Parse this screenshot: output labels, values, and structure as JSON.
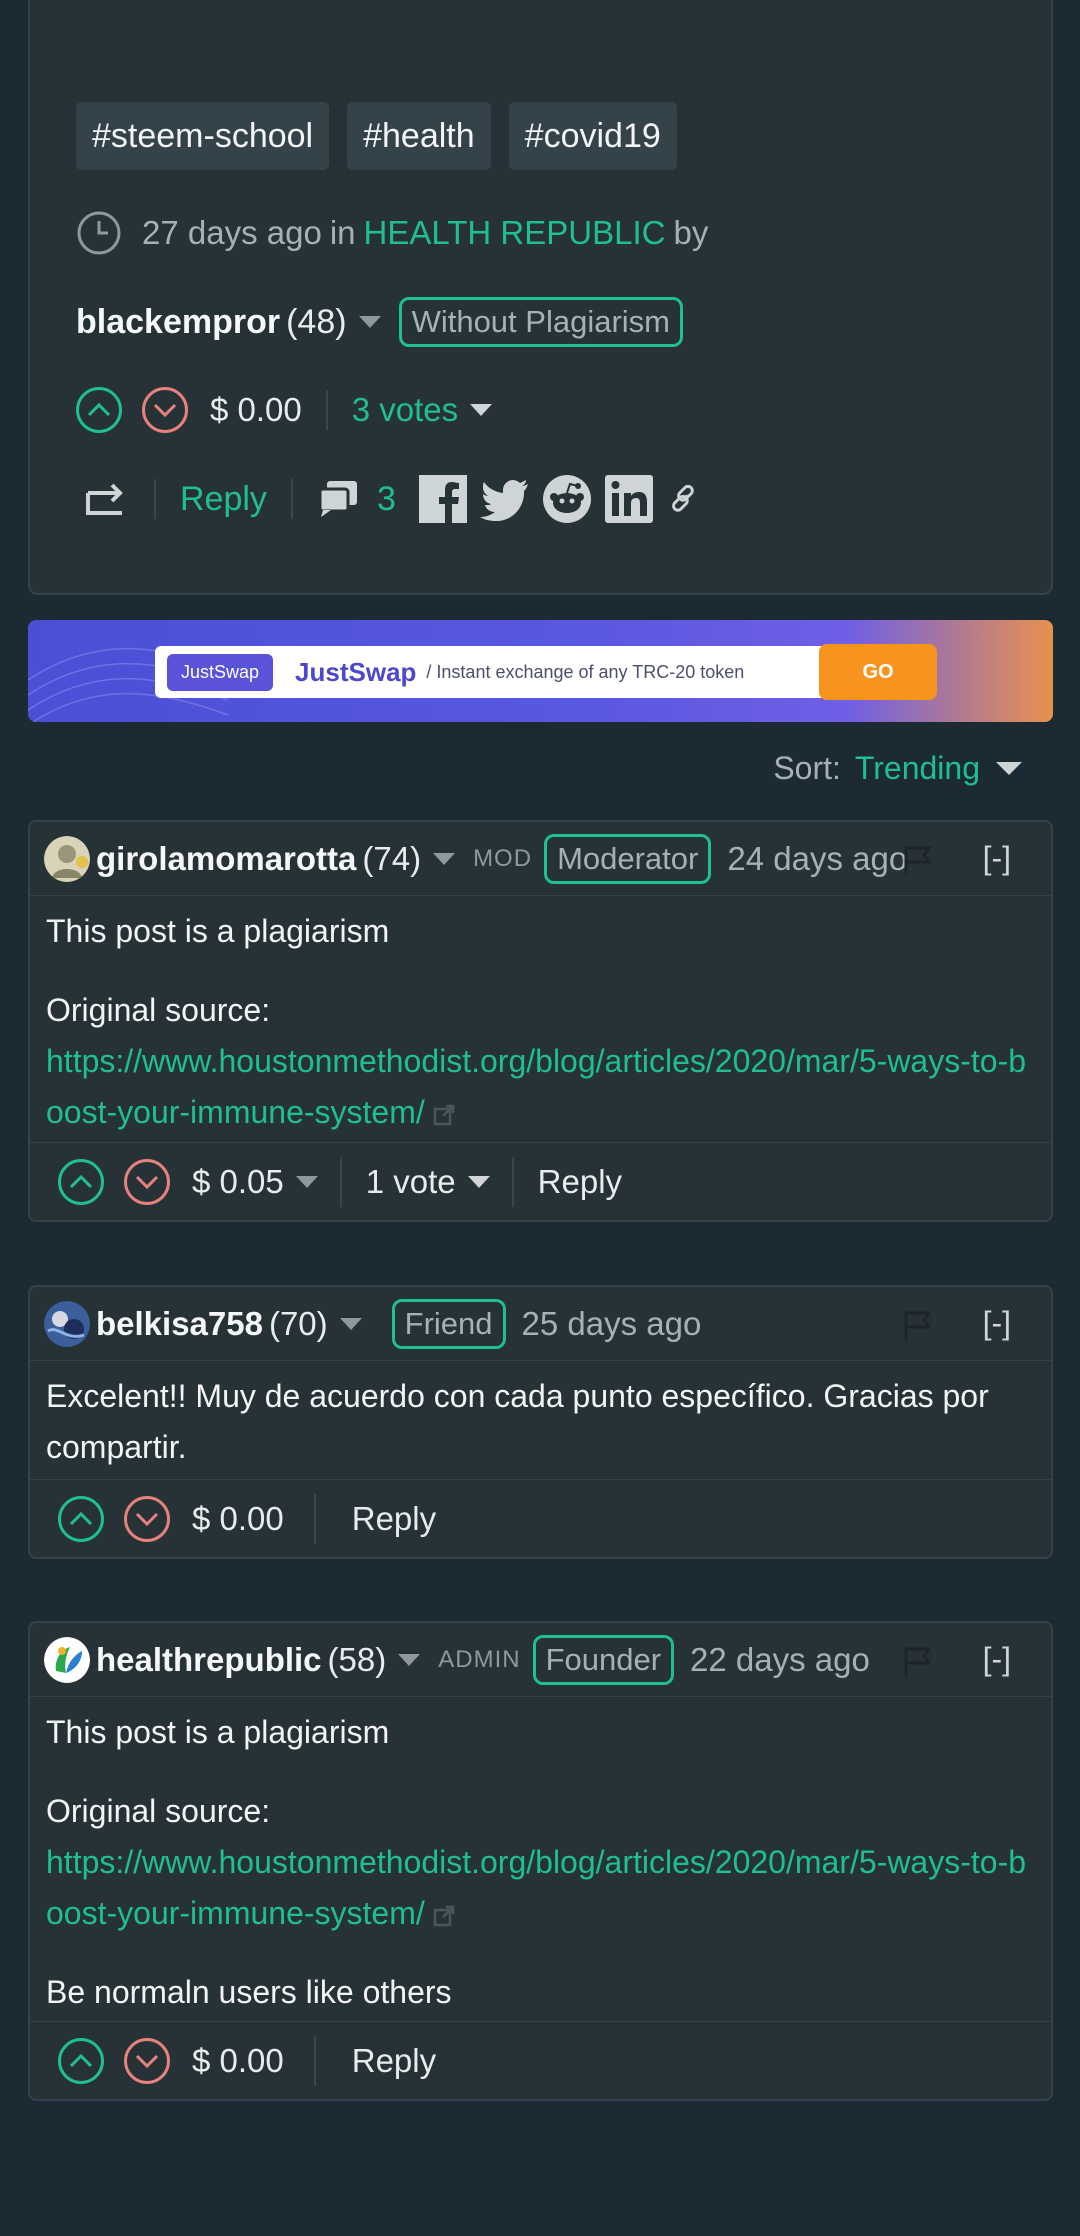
{
  "post": {
    "tags": [
      "#steem-school",
      "#health",
      "#covid19"
    ],
    "time_ago": "27 days ago",
    "in_text": "in",
    "community": "HEALTH REPUBLIC",
    "by_text": "by",
    "author": "blackempror",
    "reputation": "(48)",
    "badge": "Without Plagiarism",
    "payout": "$ 0.00",
    "votes": "3 votes",
    "reply_label": "Reply",
    "comment_count": "3"
  },
  "banner": {
    "pill": "JustSwap",
    "title": "JustSwap",
    "subtitle": "/ Instant exchange of any TRC-20 token",
    "go": "GO"
  },
  "sort": {
    "label": "Sort:",
    "value": "Trending"
  },
  "comments": [
    {
      "author": "girolamomarotta",
      "reputation": "(74)",
      "role": "MOD",
      "badge": "Moderator",
      "time": "24 days ago",
      "collapse": "[-]",
      "line1": "This post is a plagiarism",
      "source_label": "Original source:",
      "link": "https://www.houstonmethodist.org/blog/articles/2020/mar/5-ways-to-boost-your-immune-system/",
      "payout": "$ 0.05",
      "votes": "1 vote",
      "reply": "Reply"
    },
    {
      "author": "belkisa758",
      "reputation": "(70)",
      "badge": "Friend",
      "time": "25 days ago",
      "collapse": "[-]",
      "text": "Excelent!! Muy de acuerdo con cada punto específico. Gracias por compartir.",
      "payout": "$ 0.00",
      "reply": "Reply"
    },
    {
      "author": "healthrepublic",
      "reputation": "(58)",
      "role": "ADMIN",
      "badge": "Founder",
      "time": "22 days ago",
      "collapse": "[-]",
      "line1": "This post is a plagiarism",
      "source_label": "Original source:",
      "link": "https://www.houstonmethodist.org/blog/articles/2020/mar/5-ways-to-boost-your-immune-system/",
      "line3": "Be normaln users like others",
      "payout": "$ 0.00",
      "reply": "Reply"
    }
  ],
  "colors": {
    "background": "#1c2a33",
    "card": "#273236",
    "accent": "#1fbf8f",
    "downvote": "#e7827d"
  }
}
